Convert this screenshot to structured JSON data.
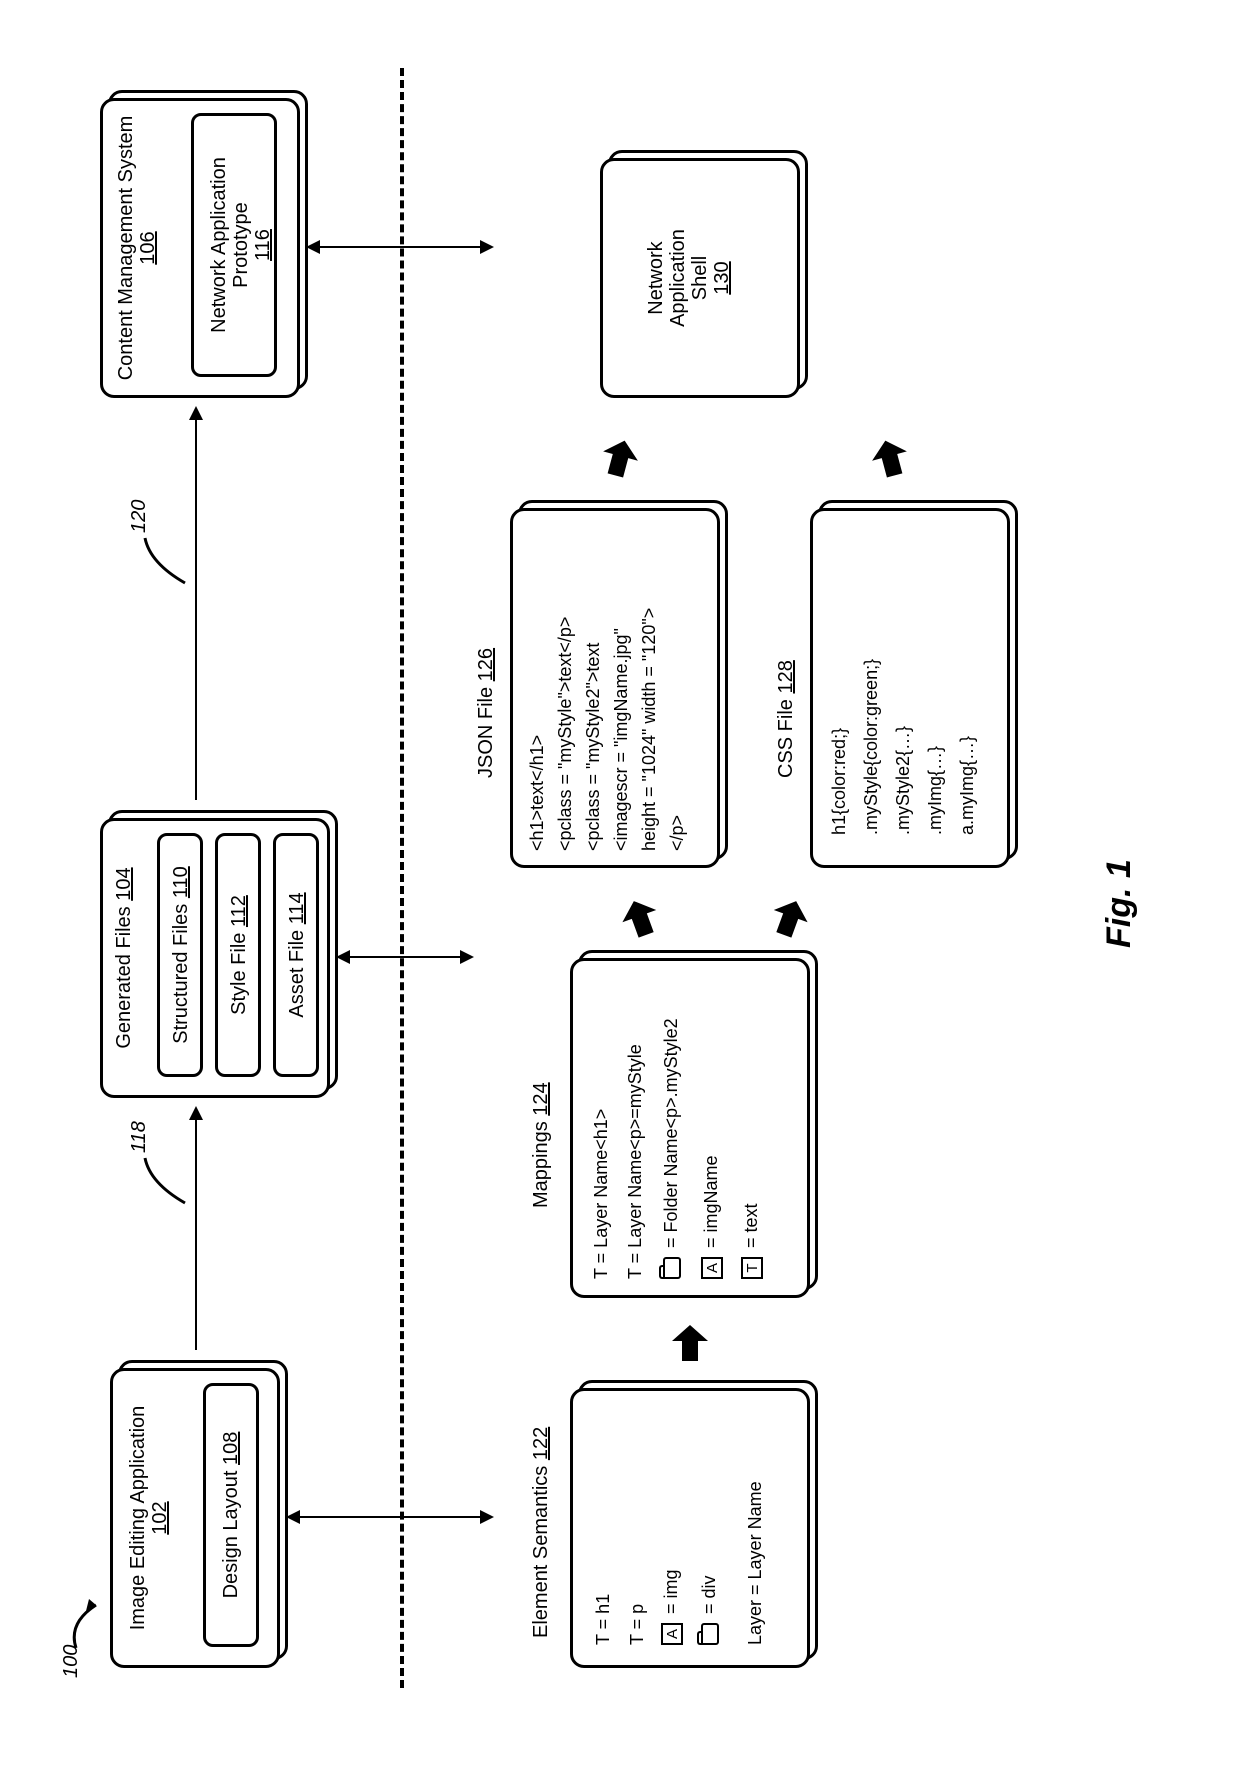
{
  "figure_label": "Fig. 1",
  "ref_100": "100",
  "ref_118": "118",
  "ref_120": "120",
  "top": {
    "image_editing": {
      "title": "Image Editing Application",
      "num": "102",
      "inner": {
        "label": "Design Layout",
        "num": "108"
      }
    },
    "generated_files": {
      "title": "Generated Files",
      "num": "104",
      "rows": [
        {
          "label": "Structured Files",
          "num": "110"
        },
        {
          "label": "Style File",
          "num": "112"
        },
        {
          "label": "Asset File",
          "num": "114"
        }
      ]
    },
    "cms": {
      "title": "Content Management System",
      "num": "106",
      "inner": {
        "label": "Network Application Prototype",
        "num": "116"
      }
    }
  },
  "bottom": {
    "element_semantics": {
      "title": "Element Semantics",
      "num": "122",
      "lines": {
        "l1": "T = h1",
        "l2": "T = p",
        "l3_after": " = img",
        "l4_after": " = div",
        "l5": "Layer = Layer Name"
      }
    },
    "mappings": {
      "title": "Mappings",
      "num": "124",
      "lines": {
        "l1": "T = Layer Name<h1>",
        "l2": "T = Layer Name<p>=myStyle",
        "l3_after": " = Folder Name<p>.myStyle2",
        "l4_in": "A",
        "l4_after": " = imgName",
        "l5_in": "T",
        "l5_after": " = text"
      }
    },
    "json_file": {
      "title": "JSON File",
      "num": "126",
      "lines": {
        "l1": "<h1>text</h1>",
        "l2": "<pclass = \"myStyle\">text</p>",
        "l3": "<pclass = \"myStyle2\">text",
        "l4": "<imagescr = \"imgName.jpg\"",
        "l5": " height = \"1024\" width = \"120\">",
        "l6": "</p>"
      }
    },
    "css_file": {
      "title": "CSS File",
      "num": "128",
      "lines": {
        "l1": "h1{color:red;}",
        "l2": ".myStyle{color:green;}",
        "l3": ".myStyle2{…}",
        "l4": ".myImg{…}",
        "l5": "a.myImg{…}"
      }
    },
    "shell": {
      "l1": "Network",
      "l2": "Application",
      "l3": "Shell",
      "num": "130"
    }
  },
  "icons": {
    "A": "A"
  }
}
